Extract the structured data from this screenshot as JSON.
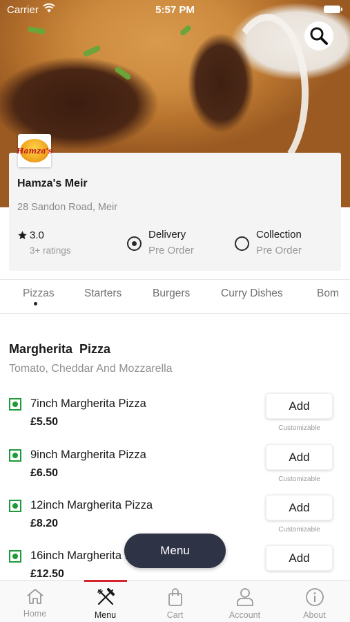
{
  "status_bar": {
    "carrier": "Carrier",
    "time": "5:57 PM"
  },
  "restaurant": {
    "logo_text": "Hamza's",
    "name": "Hamza's Meir",
    "address": "28 Sandon Road, Meir",
    "rating": "3.0",
    "rating_count": "3+ ratings",
    "options": [
      {
        "title": "Delivery",
        "subtitle": "Pre Order",
        "selected": true
      },
      {
        "title": "Collection",
        "subtitle": "Pre Order",
        "selected": false
      }
    ]
  },
  "categories": [
    "Pizzas",
    "Starters",
    "Burgers",
    "Curry Dishes",
    "Bom"
  ],
  "active_category": "Pizzas",
  "section": {
    "title": "Margherita  Pizza",
    "description": "Tomato, Cheddar And Mozzarella",
    "items": [
      {
        "name": "7inch Margherita Pizza",
        "price": "£5.50",
        "add": "Add",
        "note": "Customizable"
      },
      {
        "name": "9inch Margherita Pizza",
        "price": "£6.50",
        "add": "Add",
        "note": "Customizable"
      },
      {
        "name": "12inch Margherita Pizza",
        "price": "£8.20",
        "add": "Add",
        "note": "Customizable"
      },
      {
        "name": "16inch Margherita Pizza",
        "price": "£12.50",
        "add": "Add",
        "note": ""
      }
    ]
  },
  "menu_button": "Menu",
  "tabs": [
    {
      "label": "Home",
      "icon": "home-icon"
    },
    {
      "label": "Menu",
      "icon": "fork-knife-icon"
    },
    {
      "label": "Cart",
      "icon": "bag-icon"
    },
    {
      "label": "Account",
      "icon": "person-icon"
    },
    {
      "label": "About",
      "icon": "info-icon"
    }
  ],
  "active_tab": "Menu",
  "colors": {
    "accent": "#d6242f",
    "menu_button": "#2f3346",
    "veg": "#1f9a3a"
  }
}
